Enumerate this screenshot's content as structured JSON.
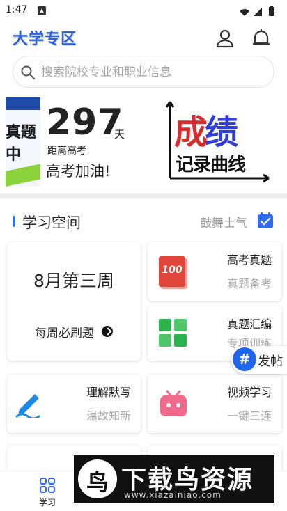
{
  "status_bar": {
    "time": "1:47"
  },
  "header": {
    "brand": "大学专区"
  },
  "search": {
    "placeholder": "搜索院校专业和职业信息"
  },
  "banner": {
    "side_text_top": "真题",
    "side_text_bottom": "中",
    "days": "297",
    "days_unit": "天",
    "subtitle": "距离高考",
    "cheer": "高考加油!",
    "graphic_title_1": "成",
    "graphic_title_2": "绩",
    "graphic_subtitle": "记录曲线"
  },
  "study_section": {
    "title": "学习空间",
    "encourage_label": "鼓舞士气",
    "week_card": {
      "title": "8月第三周",
      "link": "每周必刷题"
    },
    "cards": [
      {
        "name": "高考真题",
        "desc": "真题备考",
        "icon": "score-100-icon"
      },
      {
        "name": "真题汇编",
        "desc": "专项训练",
        "icon": "grid-icon"
      },
      {
        "name": "理解默写",
        "desc": "温故知新",
        "icon": "pen-icon"
      },
      {
        "name": "视频学习",
        "desc": "一键三连",
        "icon": "tv-icon"
      }
    ],
    "icon_100_text": "100"
  },
  "fab": {
    "label": "发帖",
    "icon": "hash-icon"
  },
  "tabbar": {
    "tabs": [
      {
        "label": "学习",
        "icon": "grid-apps-icon"
      }
    ]
  },
  "watermark": {
    "text": "下载鸟资源",
    "url": "www.xiazainiao.com"
  },
  "colors": {
    "accent": "#2f6bf2",
    "fab": "#1f65f0",
    "green_icon": "#2bb24c",
    "red_icon": "#e0463a",
    "pink_icon": "#f06a8c",
    "blue_pen": "#1e88e5"
  }
}
